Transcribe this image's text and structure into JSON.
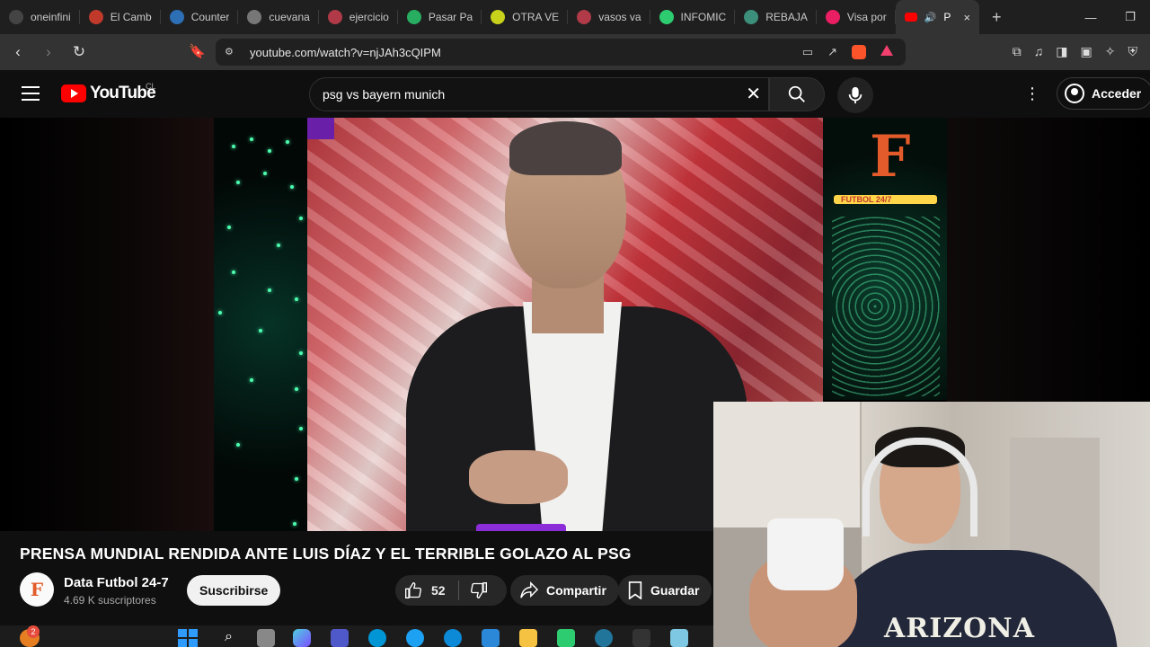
{
  "browser": {
    "tabs": [
      {
        "title": "oneinfini",
        "color": "#444"
      },
      {
        "title": "El Camb",
        "color": "#c0392b"
      },
      {
        "title": "Counter",
        "color": "#2c6fb5"
      },
      {
        "title": "cuevana",
        "color": "#777"
      },
      {
        "title": "ejercicio",
        "color": "#b03a48"
      },
      {
        "title": "Pasar Pa",
        "color": "#27ae60"
      },
      {
        "title": "OTRA VE",
        "color": "#c9d21b"
      },
      {
        "title": "vasos va",
        "color": "#b03a48"
      },
      {
        "title": "INFOMIC",
        "color": "#2ecc71"
      },
      {
        "title": "REBAJA",
        "color": "#3c8f7a"
      },
      {
        "title": "Visa por",
        "color": "#e91e63"
      }
    ],
    "active_tab": {
      "title": "P",
      "close": "×"
    },
    "new_tab": "+",
    "window_controls": [
      "—",
      "❐",
      "✕"
    ],
    "url": "youtube.com/watch?v=njJAh3cQIPM"
  },
  "youtube": {
    "logo_text": "YouTube",
    "country_code": "CL",
    "search_query": "psg vs bayern munich",
    "signin_label": "Acceder"
  },
  "video": {
    "overlay_brand": "FUTBOL 24/7",
    "title": "PRENSA MUNDIAL RENDIDA ANTE LUIS DÍAZ Y EL TERRIBLE GOLAZO AL PSG",
    "channel_name": "Data Futbol 24-7",
    "subscribers": "4.69 K suscriptores",
    "subscribe_label": "Suscribirse",
    "like_count": "52",
    "share_label": "Compartir",
    "save_label": "Guardar"
  },
  "webcam": {
    "shirt_text": "ARIZONA"
  },
  "taskbar": {
    "notification_count": "2"
  }
}
